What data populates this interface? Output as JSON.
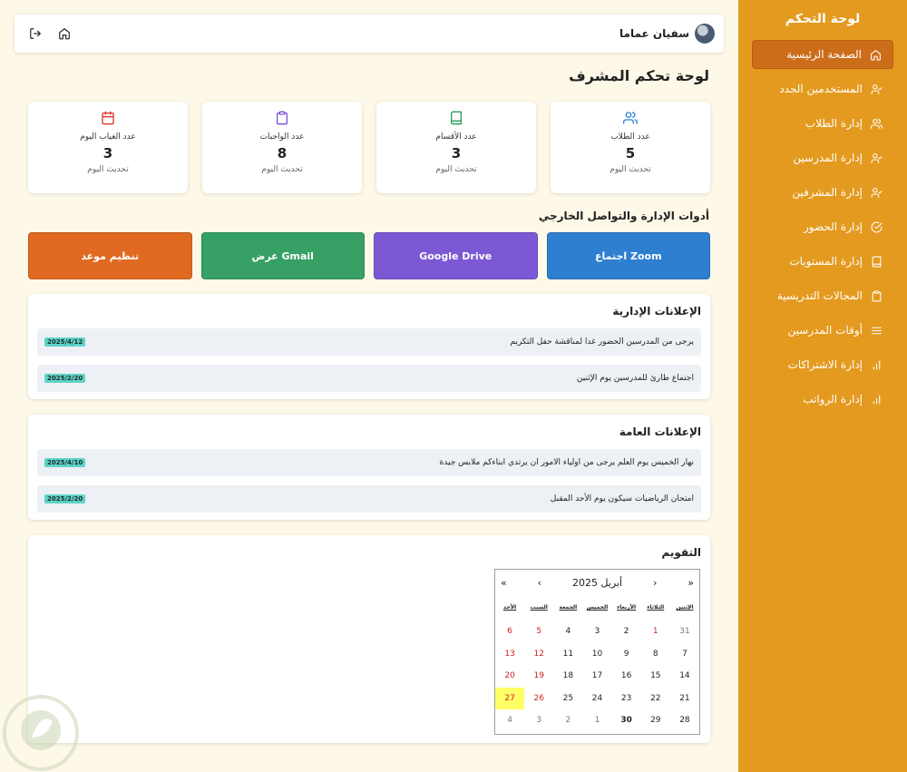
{
  "sidebar": {
    "title": "لوحة التحكم",
    "items": [
      {
        "label": "الصفحة الرئيسية",
        "icon": "home-icon",
        "active": true
      },
      {
        "label": "المستخدمين الجدد",
        "icon": "user-check-icon"
      },
      {
        "label": "إدارة الطلاب",
        "icon": "users-icon"
      },
      {
        "label": "إدارة المدرسين",
        "icon": "user-check-icon"
      },
      {
        "label": "إدارة المشرفين",
        "icon": "user-check-icon"
      },
      {
        "label": "إدارة الحضور",
        "icon": "check-circle-icon"
      },
      {
        "label": "إدارة المستويات",
        "icon": "book-icon"
      },
      {
        "label": "المجالات التدريسية",
        "icon": "clipboard-icon"
      },
      {
        "label": "أوقات المدرسين",
        "icon": "list-icon"
      },
      {
        "label": "إدارة الاشتراكات",
        "icon": "bar-chart-icon"
      },
      {
        "label": "إدارة الرواتب",
        "icon": "bar-chart-icon"
      }
    ]
  },
  "topbar": {
    "user_name": "سفيان عماما"
  },
  "page_title": "لوحة تحكم المشرف",
  "stats": [
    {
      "label": "عدد الطلاب",
      "value": "5",
      "sub": "تحديث اليوم",
      "color": "#2f80d8",
      "icon": "users-icon"
    },
    {
      "label": "عدد الأقسام",
      "value": "3",
      "sub": "تحديث اليوم",
      "color": "#2f9c5a",
      "icon": "book-icon"
    },
    {
      "label": "عدد الواجبات",
      "value": "8",
      "sub": "تحديث اليوم",
      "color": "#7b4fd6",
      "icon": "clipboard-icon"
    },
    {
      "label": "عدد الغياب اليوم",
      "value": "3",
      "sub": "تحديث اليوم",
      "color": "#e0382f",
      "icon": "calendar-icon"
    }
  ],
  "tools_title": "أدوات الإدارة والتواصل الخارجي",
  "tools": [
    {
      "label": "اجتماع Zoom",
      "color": "#2f7fd1"
    },
    {
      "label": "Google Drive",
      "color": "#7b59d4"
    },
    {
      "label": "عرض Gmail",
      "color": "#36a065"
    },
    {
      "label": "تنظيم موعد",
      "color": "#e06a22"
    }
  ],
  "admin_announcements": {
    "title": "الإعلانات الإدارية",
    "items": [
      {
        "text": "يرجى من المدرسين الحضور غدا لمناقشة حفل التكريم",
        "date": "2025/4/12"
      },
      {
        "text": "اجتماع طارئ للمدرسين يوم الإثنين",
        "date": "2025/2/20"
      }
    ]
  },
  "general_announcements": {
    "title": "الإعلانات العامة",
    "items": [
      {
        "text": "نهار الخميس يوم العلم يرجى من اولياء الامور ان يرتدي ابناءكم ملابس جيدة",
        "date": "2025/4/10"
      },
      {
        "text": "امتحان الرياضيات سيكون يوم الأحد المقبل",
        "date": "2025/2/20"
      }
    ]
  },
  "calendar": {
    "title": "التقويم",
    "month_label": "أبريل 2025",
    "nav": {
      "first": "«",
      "prev": "‹",
      "next": "›",
      "last": "»"
    },
    "weekdays": [
      "الإثنين",
      "الثلاثاء",
      "الأربعاء",
      "الخميس",
      "الجمعة",
      "السبت",
      "الأحد"
    ],
    "weeks": [
      [
        {
          "d": "31",
          "c": "other"
        },
        {
          "d": "1",
          "c": "weekend"
        },
        {
          "d": "2",
          "c": ""
        },
        {
          "d": "3",
          "c": ""
        },
        {
          "d": "4",
          "c": ""
        },
        {
          "d": "5",
          "c": "weekend"
        },
        {
          "d": "6",
          "c": "weekend"
        }
      ],
      [
        {
          "d": "7",
          "c": ""
        },
        {
          "d": "8",
          "c": ""
        },
        {
          "d": "9",
          "c": ""
        },
        {
          "d": "10",
          "c": ""
        },
        {
          "d": "11",
          "c": ""
        },
        {
          "d": "12",
          "c": "weekend"
        },
        {
          "d": "13",
          "c": "weekend"
        }
      ],
      [
        {
          "d": "14",
          "c": ""
        },
        {
          "d": "15",
          "c": ""
        },
        {
          "d": "16",
          "c": ""
        },
        {
          "d": "17",
          "c": ""
        },
        {
          "d": "18",
          "c": ""
        },
        {
          "d": "19",
          "c": "weekend"
        },
        {
          "d": "20",
          "c": "weekend"
        }
      ],
      [
        {
          "d": "21",
          "c": ""
        },
        {
          "d": "22",
          "c": ""
        },
        {
          "d": "23",
          "c": ""
        },
        {
          "d": "24",
          "c": ""
        },
        {
          "d": "25",
          "c": ""
        },
        {
          "d": "26",
          "c": "weekend"
        },
        {
          "d": "27",
          "c": "today weekend"
        }
      ],
      [
        {
          "d": "28",
          "c": ""
        },
        {
          "d": "29",
          "c": ""
        },
        {
          "d": "30",
          "c": "bold"
        },
        {
          "d": "1",
          "c": "other"
        },
        {
          "d": "2",
          "c": "other"
        },
        {
          "d": "3",
          "c": "other"
        },
        {
          "d": "4",
          "c": "other"
        }
      ]
    ]
  }
}
